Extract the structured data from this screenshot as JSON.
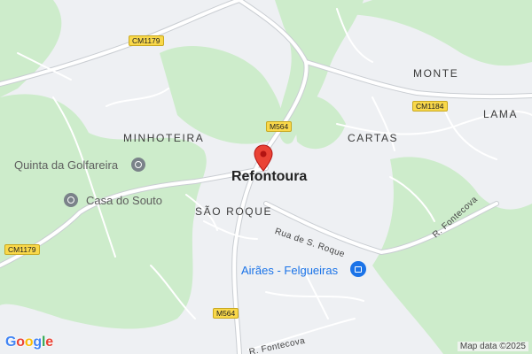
{
  "map": {
    "colors": {
      "background": "#eef0f3",
      "green": "#cdeccb",
      "road": "#ffffff",
      "road_casing": "#c9cdd2",
      "marker": "#ea4335"
    },
    "labels": {
      "town": "Refontoura",
      "areas": [
        "MINHOTEIRA",
        "SÃO ROQUE",
        "CARTAS",
        "MONTE",
        "LAMA"
      ],
      "pois": [
        "Quinta da Golfareira",
        "Casa do Souto"
      ],
      "store": "Airães - Felgueiras",
      "streets": [
        "Rua de S. Roque",
        "R. Fontecova",
        "R. Fontecova"
      ]
    },
    "road_shields": [
      "CM1179",
      "M564",
      "CM1184",
      "CM1179",
      "M564"
    ],
    "icons": {
      "marker": "red-location-pin-icon",
      "poi": "landmark-pin-icon",
      "store": "shopping-bag-icon"
    },
    "branding": {
      "logo_letters": [
        "G",
        "o",
        "o",
        "g",
        "l",
        "e"
      ],
      "logo_colors": [
        "#4285f4",
        "#ea4335",
        "#fbbc05",
        "#4285f4",
        "#34a853",
        "#ea4335"
      ],
      "attribution": "Map data ©2025"
    }
  }
}
